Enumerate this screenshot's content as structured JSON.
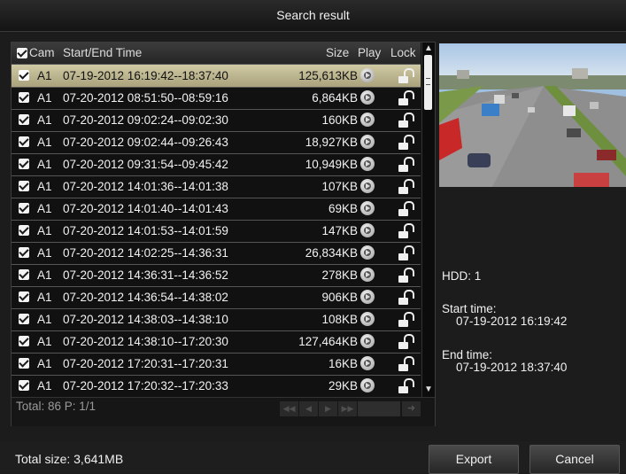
{
  "window": {
    "title": "Search result"
  },
  "table": {
    "headers": {
      "cam": "Cam",
      "time": "Start/End Time",
      "size": "Size",
      "play": "Play",
      "lock": "Lock"
    },
    "rows": [
      {
        "cam": "A1",
        "time": "07-19-2012 16:19:42--18:37:40",
        "size": "125,613KB",
        "selected": true
      },
      {
        "cam": "A1",
        "time": "07-20-2012 08:51:50--08:59:16",
        "size": "6,864KB"
      },
      {
        "cam": "A1",
        "time": "07-20-2012 09:02:24--09:02:30",
        "size": "160KB"
      },
      {
        "cam": "A1",
        "time": "07-20-2012 09:02:44--09:26:43",
        "size": "18,927KB"
      },
      {
        "cam": "A1",
        "time": "07-20-2012 09:31:54--09:45:42",
        "size": "10,949KB"
      },
      {
        "cam": "A1",
        "time": "07-20-2012 14:01:36--14:01:38",
        "size": "107KB"
      },
      {
        "cam": "A1",
        "time": "07-20-2012 14:01:40--14:01:43",
        "size": "69KB"
      },
      {
        "cam": "A1",
        "time": "07-20-2012 14:01:53--14:01:59",
        "size": "147KB"
      },
      {
        "cam": "A1",
        "time": "07-20-2012 14:02:25--14:36:31",
        "size": "26,834KB"
      },
      {
        "cam": "A1",
        "time": "07-20-2012 14:36:31--14:36:52",
        "size": "278KB"
      },
      {
        "cam": "A1",
        "time": "07-20-2012 14:36:54--14:38:02",
        "size": "906KB"
      },
      {
        "cam": "A1",
        "time": "07-20-2012 14:38:03--14:38:10",
        "size": "108KB"
      },
      {
        "cam": "A1",
        "time": "07-20-2012 14:38:10--17:20:30",
        "size": "127,464KB"
      },
      {
        "cam": "A1",
        "time": "07-20-2012 17:20:31--17:20:31",
        "size": "16KB"
      },
      {
        "cam": "A1",
        "time": "07-20-2012 17:20:32--17:20:33",
        "size": "29KB"
      }
    ]
  },
  "footer": {
    "total": "Total: 86  P: 1/1"
  },
  "pager_icons": [
    "first-page-icon",
    "prev-page-icon",
    "next-page-icon",
    "last-page-icon",
    "go-arrow-icon"
  ],
  "info": {
    "hdd": "HDD: 1",
    "start_label": "Start time:",
    "start_value": "07-19-2012 16:19:42",
    "end_label": "End time:",
    "end_value": "07-19-2012 18:37:40"
  },
  "bottom": {
    "total_size": "Total size: 3,641MB",
    "export": "Export",
    "cancel": "Cancel"
  }
}
